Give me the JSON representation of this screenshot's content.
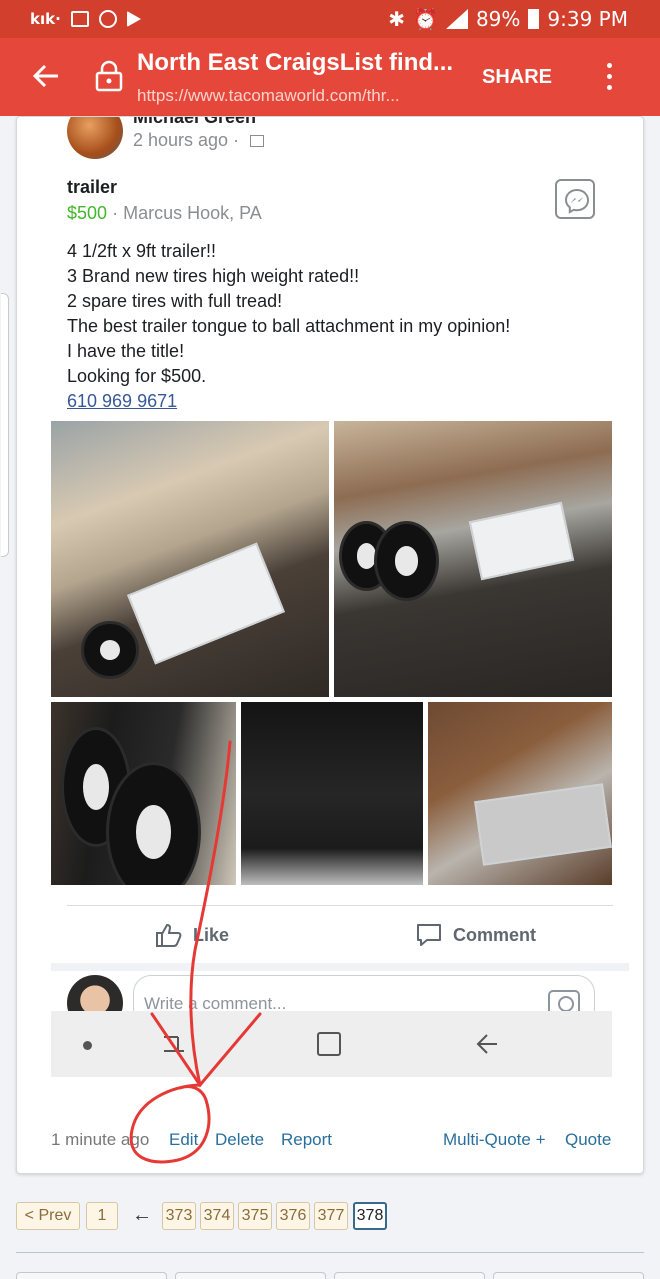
{
  "status_bar": {
    "app_icons": [
      "kik-icon",
      "image-icon",
      "car-icon",
      "play-store-icon"
    ],
    "kik": "kık·",
    "battery": "89%",
    "time": "9:39 PM",
    "network": "LTE"
  },
  "browser": {
    "title": "North East CraigsList find...",
    "url": "https://www.tacomaworld.com/thr...",
    "share_label": "SHARE"
  },
  "fb_post": {
    "author": "Michael Green",
    "time": "2 hours ago",
    "listing_title": "trailer",
    "price": "$500",
    "separator": "·",
    "location": "Marcus Hook, PA",
    "description": [
      "4 1/2ft x 9ft trailer!!",
      "3 Brand new tires high weight  rated!!",
      "2 spare tires with full tread!",
      "The best trailer tongue to ball attachment in my opinion!",
      "I have the title!",
      "Looking for $500."
    ],
    "phone": "610 969 9671",
    "like_label": "Like",
    "comment_label": "Comment",
    "comment_placeholder": "Write a comment..."
  },
  "post_footer": {
    "time": "1 minute ago",
    "edit": "Edit",
    "delete": "Delete",
    "report": "Report",
    "multi_quote": "Multi-Quote +",
    "quote": "Quote"
  },
  "pagination": {
    "prev": "< Prev",
    "first": "1",
    "arrow": "←",
    "pages": [
      "373",
      "374",
      "375",
      "376",
      "377",
      "378"
    ],
    "current": "378"
  },
  "colors": {
    "status_bar": "#d23f2d",
    "app_bar": "#e5483a",
    "price_green": "#42b72a",
    "link_blue": "#2a6f9b",
    "annotation_red": "#e53935"
  }
}
